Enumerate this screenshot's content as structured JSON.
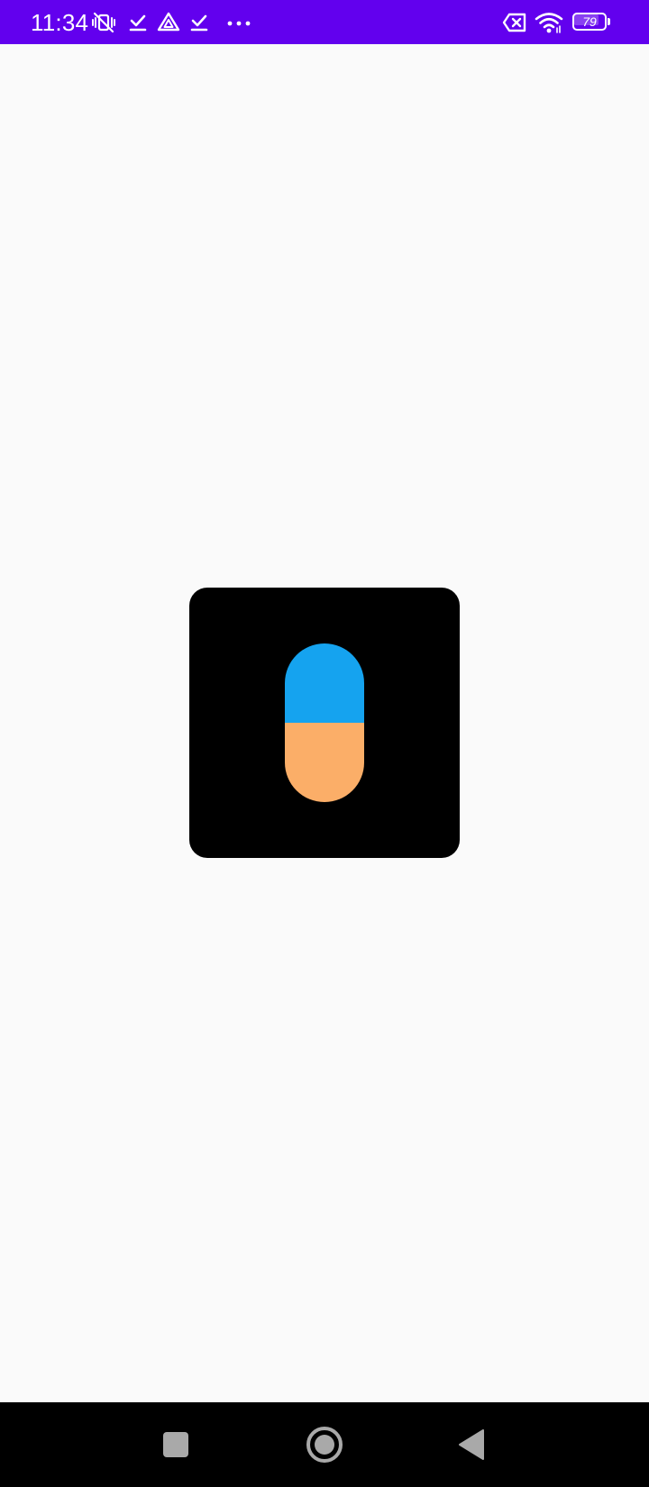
{
  "status_bar": {
    "time": "11:34",
    "battery_level": "79",
    "background_color": "#6200ee",
    "left_icons": [
      "vibrate-off-icon",
      "download-done-icon",
      "drive-icon",
      "download-done-icon",
      "more-dots-icon"
    ],
    "right_icons": [
      "no-sim-icon",
      "wifi-icon",
      "battery-icon"
    ]
  },
  "app_icon": {
    "icon_name": "capsule-pill-icon",
    "background_color": "#000000",
    "capsule_top_color": "#15a3ef",
    "capsule_bottom_color": "#fbae68"
  },
  "nav_bar": {
    "background_color": "#000000",
    "buttons": [
      "recents-button",
      "home-button",
      "back-button"
    ]
  }
}
